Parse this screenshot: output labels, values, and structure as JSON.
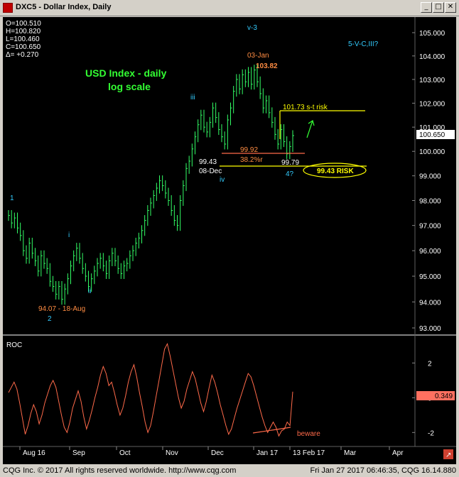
{
  "window": {
    "title": "DXC5 - Dollar Index, Daily",
    "min_glyph": "_",
    "max_glyph": "□",
    "close_glyph": "✕"
  },
  "ohlc": {
    "open": "O=100.510",
    "high": "H=100.820",
    "low": "L=100.460",
    "close": "C=100.650",
    "change": "Δ= +0.270"
  },
  "chart_data": [
    {
      "type": "bar",
      "title": "USD Index - daily",
      "subtitle": "log scale",
      "scale": "log",
      "ylim": [
        93.0,
        105.0
      ],
      "y_ticks": [
        "105.000",
        "104.000",
        "103.000",
        "102.000",
        "101.000",
        "100.000",
        "99.000",
        "98.000",
        "97.000",
        "96.000",
        "95.000",
        "94.000",
        "93.000"
      ],
      "last_value": "100.650",
      "x_ticks": [
        "Aug 16",
        "Sep",
        "Oct",
        "Nov",
        "Dec",
        "Jan 17",
        "13 Feb 17",
        "Mar",
        "Apr"
      ],
      "closes_approx": [
        97.4,
        97.1,
        97.3,
        96.9,
        96.6,
        96.0,
        95.7,
        96.3,
        95.9,
        95.6,
        95.2,
        95.8,
        95.5,
        95.3,
        94.8,
        94.6,
        94.3,
        94.6,
        94.1,
        94.5,
        94.9,
        95.4,
        95.8,
        96.1,
        95.7,
        95.3,
        95.0,
        94.6,
        94.9,
        95.2,
        95.5,
        95.7,
        95.4,
        95.1,
        95.6,
        95.9,
        95.6,
        95.3,
        95.1,
        95.4,
        95.5,
        95.8,
        96.0,
        96.3,
        96.5,
        96.8,
        97.2,
        97.6,
        97.9,
        98.2,
        98.5,
        98.8,
        98.6,
        98.3,
        98.0,
        97.6,
        97.2,
        97.0,
        98.0,
        98.6,
        99.3,
        99.6,
        100.1,
        100.6,
        101.1,
        101.5,
        101.0,
        100.8,
        101.2,
        101.8,
        101.4,
        100.9,
        100.6,
        100.3,
        101.3,
        101.8,
        102.5,
        103.0,
        102.6,
        103.2,
        102.9,
        103.3,
        102.8,
        103.4,
        102.9,
        102.4,
        101.8,
        102.1,
        101.6,
        101.2,
        100.7,
        100.3,
        100.9,
        100.4,
        99.9,
        100.2,
        100.65
      ],
      "annotations": [
        "v-3",
        "03-Jan",
        "103.82",
        "iii",
        "101.73 s-t risk",
        "99.92",
        "38.2%r",
        "99.43",
        "08-Dec",
        "iv",
        "99.79",
        "4?",
        "99.43 RISK",
        "1",
        "i",
        "ii",
        "94.07 - 18-Aug",
        "2",
        "5-V-C,III?"
      ]
    },
    {
      "type": "line",
      "title": "ROC",
      "ylim": [
        -2.6,
        3.2
      ],
      "y_ticks": [
        "2",
        "0",
        "-2"
      ],
      "last_value": "0.349",
      "values_approx": [
        0.3,
        0.6,
        0.9,
        0.5,
        -0.3,
        -1.2,
        -2.1,
        -1.6,
        -0.9,
        -0.4,
        -0.8,
        -1.5,
        -1.0,
        -0.3,
        0.2,
        0.7,
        1.0,
        0.6,
        -0.2,
        -1.0,
        -1.7,
        -2.0,
        -1.4,
        -0.6,
        -0.1,
        0.4,
        -0.2,
        -1.1,
        -1.8,
        -1.3,
        -0.7,
        0.0,
        0.6,
        1.3,
        1.8,
        1.4,
        0.7,
        0.9,
        0.3,
        -0.4,
        -1.0,
        -0.6,
        0.1,
        0.9,
        1.5,
        1.9,
        1.2,
        0.3,
        -0.5,
        -1.4,
        -2.0,
        -1.6,
        -0.8,
        0.1,
        1.0,
        1.9,
        2.8,
        3.1,
        2.4,
        1.6,
        0.8,
        0.0,
        -0.6,
        -0.2,
        0.5,
        1.0,
        1.5,
        1.1,
        0.4,
        -0.3,
        -0.8,
        -0.2,
        0.6,
        1.3,
        0.9,
        0.3,
        -0.4,
        -1.0,
        -1.6,
        -2.1,
        -1.8,
        -1.2,
        -0.6,
        -0.1,
        0.4,
        0.9,
        1.4,
        1.2,
        0.7,
        0.1,
        -0.5,
        -1.1,
        -1.6,
        -2.0,
        -1.7,
        -1.4,
        -1.7,
        -2.2,
        -1.9,
        -1.8,
        -1.4,
        -1.6,
        0.349
      ],
      "annotations": [
        "beware"
      ]
    }
  ],
  "status": {
    "left": "CQG Inc. © 2017 All rights reserved worldwide.  http://www.cqg.com",
    "right": "Fri Jan 27 2017  06:46:35, CQG 16.14.880"
  }
}
